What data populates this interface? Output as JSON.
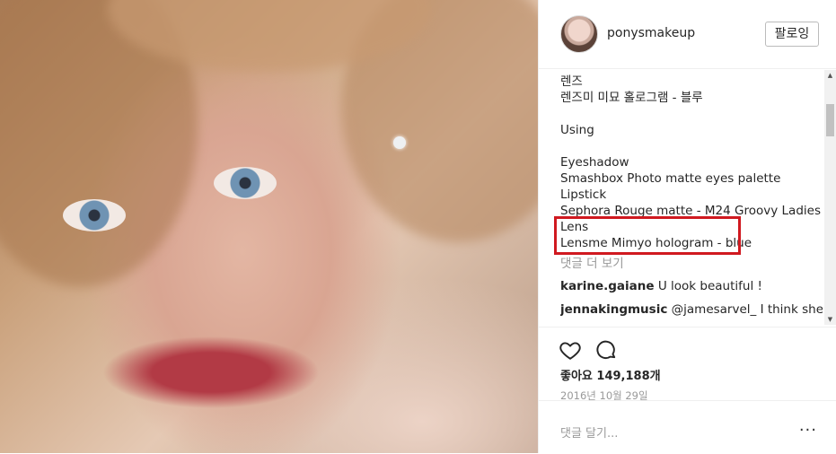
{
  "header": {
    "username": "ponysmakeup",
    "follow_label": "팔로잉"
  },
  "caption": {
    "lines_top": [
      "렌즈",
      "렌즈미 미묘 홀로그램 - 블루"
    ],
    "using": "Using",
    "lines_products": [
      "Eyeshadow",
      "Smashbox Photo matte eyes palette",
      "Lipstick",
      "Sephora Rouge matte - M24 Groovy Ladies",
      "Lens",
      "Lensme Mimyo hologram - blue"
    ]
  },
  "comments": {
    "view_more": "댓글 더 보기",
    "items": [
      {
        "user": "karine.gaiane",
        "text": "U look beautiful !"
      },
      {
        "user": "jennakingmusic",
        "text": "@jamesarvel_ I think she's"
      }
    ]
  },
  "actions": {
    "likes": "좋아요 149,188개",
    "date": "2016년 10월 29일"
  },
  "comment_box": {
    "placeholder": "댓글 달기...",
    "more": "···"
  },
  "icons": {
    "like": "heart-icon",
    "comment": "comment-icon",
    "options": "more-options-icon"
  },
  "colors": {
    "highlight": "#d01920",
    "muted": "#999999",
    "text": "#262626"
  }
}
